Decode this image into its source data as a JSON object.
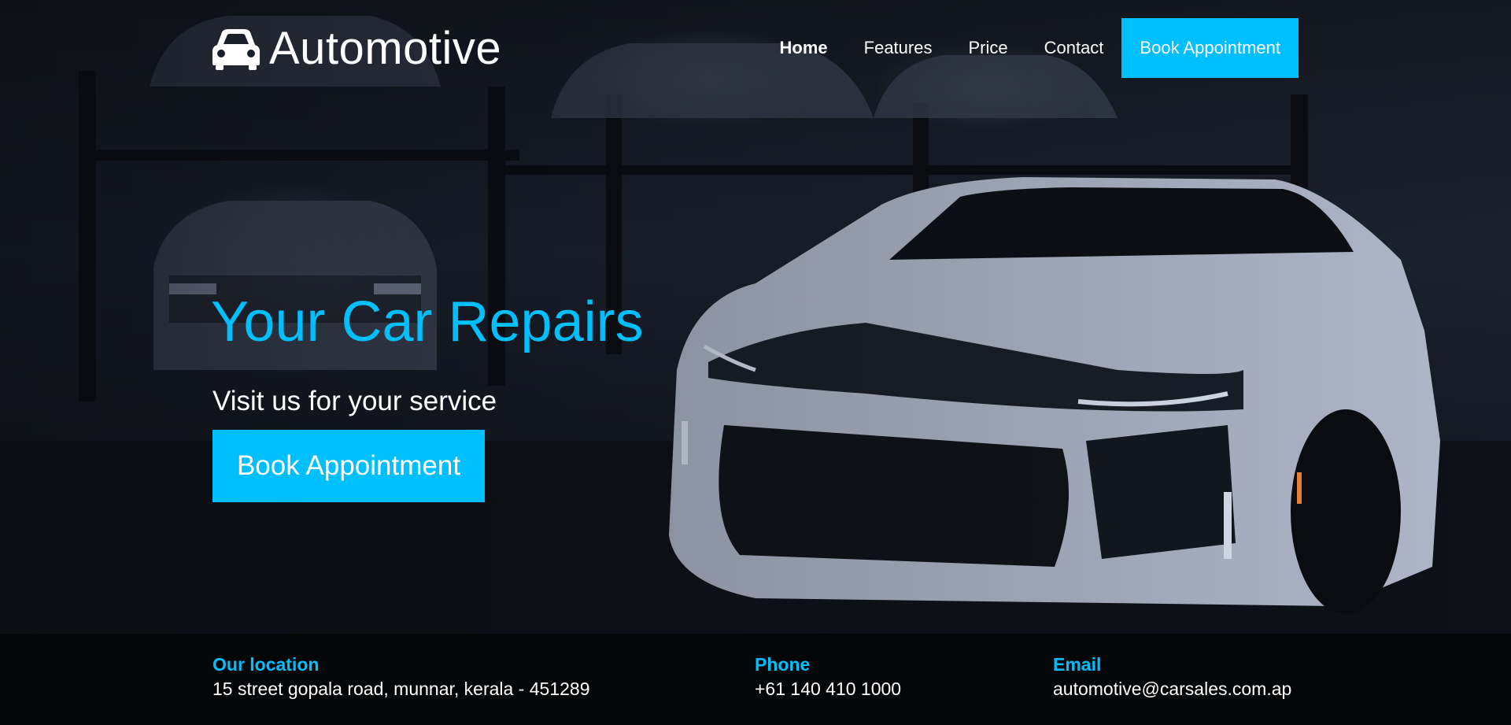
{
  "brand": {
    "name": "Automotive",
    "icon": "car-icon"
  },
  "nav": {
    "items": [
      {
        "label": "Home",
        "active": true
      },
      {
        "label": "Features",
        "active": false
      },
      {
        "label": "Price",
        "active": false
      },
      {
        "label": "Contact",
        "active": false
      }
    ],
    "cta_label": "Book Appointment"
  },
  "hero": {
    "title": "Your Car Repairs",
    "subtitle": "Visit us for your service",
    "cta_label": "Book Appointment"
  },
  "contact": {
    "location": {
      "label": "Our location",
      "value": "15 street gopala road, munnar, kerala - 451289"
    },
    "phone": {
      "label": "Phone",
      "value": "+61 140 410 1000"
    },
    "email": {
      "label": "Email",
      "value": "automotive@carsales.com.ap"
    }
  },
  "colors": {
    "accent": "#00bfff",
    "text": "#ffffff",
    "footer_bg": "#050608"
  }
}
